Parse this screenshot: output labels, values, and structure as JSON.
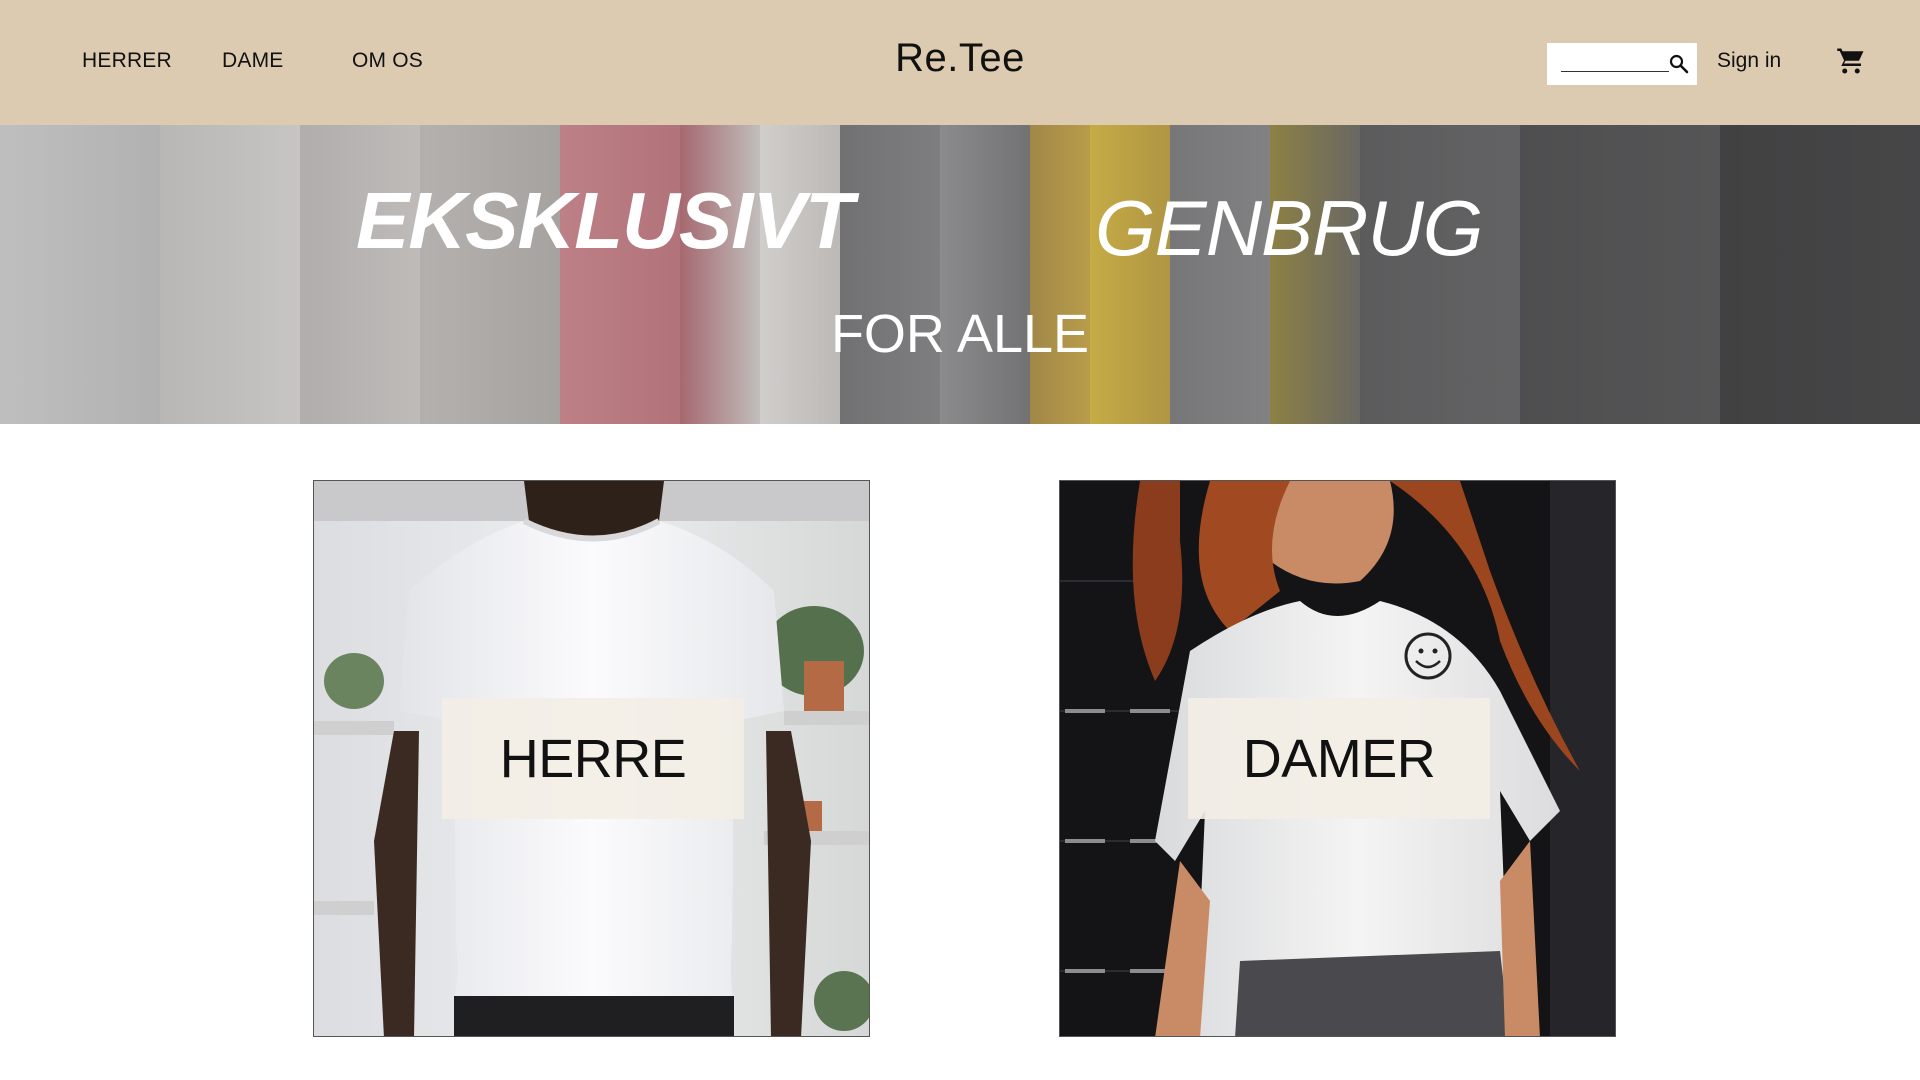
{
  "header": {
    "nav": [
      "HERRER",
      "DAME",
      "OM OS"
    ],
    "logo": "Re.Tee",
    "search": {
      "value": "",
      "placeholder": ""
    },
    "sign_in_label": "Sign in",
    "cart_icon": "shopping-cart-icon",
    "search_icon": "magnifier-icon",
    "background_color": "#dccbb0"
  },
  "hero": {
    "word1": "EKSKLUSIVT",
    "word2": "GENBRUG",
    "line2": "FOR ALLE"
  },
  "categories": [
    {
      "label": "HERRE"
    },
    {
      "label": "DAMER"
    }
  ]
}
